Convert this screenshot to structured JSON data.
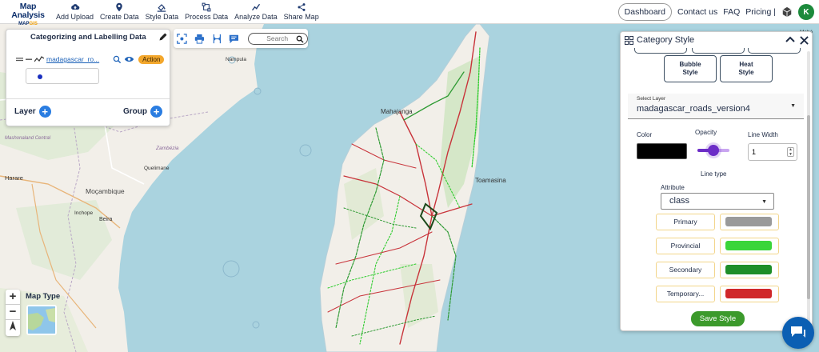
{
  "brand": {
    "title": "Map Analysis",
    "sub_a": "MAP",
    "sub_b": "GIS"
  },
  "nav": [
    {
      "label": "Add Upload",
      "icon": "cloud-upload-icon"
    },
    {
      "label": "Create Data",
      "icon": "map-pin-icon"
    },
    {
      "label": "Style Data",
      "icon": "style-icon"
    },
    {
      "label": "Process Data",
      "icon": "process-icon"
    },
    {
      "label": "Analyze Data",
      "icon": "analyze-icon"
    },
    {
      "label": "Share Map",
      "icon": "share-icon"
    }
  ],
  "top_right": {
    "dashboard": "Dashboard",
    "contact": "Contact us",
    "faq": "FAQ",
    "pricing": "Pricing |",
    "avatar": "K"
  },
  "layer_panel": {
    "title": "Categorizing and Labelling Data",
    "layer_name": "madagascar_ro...",
    "action": "Action",
    "layer_btn": "Layer",
    "group_btn": "Group"
  },
  "toolbar": {
    "search_placeholder": "Search"
  },
  "map": {
    "labels": {
      "mahajanga": "Mahajanga",
      "toamasina": "Toamasina",
      "mozambique": "Moçambique",
      "beira": "Beira",
      "harare": "Harare",
      "inchope": "Inchope",
      "quelimane": "Quelimane",
      "zambezia": "Zambézia",
      "mashonaland": "Mashonaland Central",
      "nampula": "Nampula",
      "mahe": "Mahé"
    },
    "map_type_label": "Map Type",
    "zoom_in": "+",
    "zoom_out": "−"
  },
  "category_panel": {
    "title": "Category Style",
    "bubble_style": "Bubble Style",
    "heat_style": "Heat Style",
    "select_layer_caption": "Select Layer",
    "select_layer_value": "madagascar_roads_version4",
    "color_label": "Color",
    "opacity_label": "Opacity",
    "opacity_value": 0.5,
    "line_width_label": "Line Width",
    "line_width_value": "1",
    "line_type_label": "Line type",
    "attribute_label": "Attribute",
    "attribute_value": "class",
    "categories": [
      {
        "label": "Primary",
        "color": "#9a9a9a"
      },
      {
        "label": "Provincial",
        "color": "#3ad53a"
      },
      {
        "label": "Secondary",
        "color": "#1e8e28"
      },
      {
        "label": "Temporary...",
        "color": "#d0282a"
      }
    ],
    "save": "Save Style"
  }
}
